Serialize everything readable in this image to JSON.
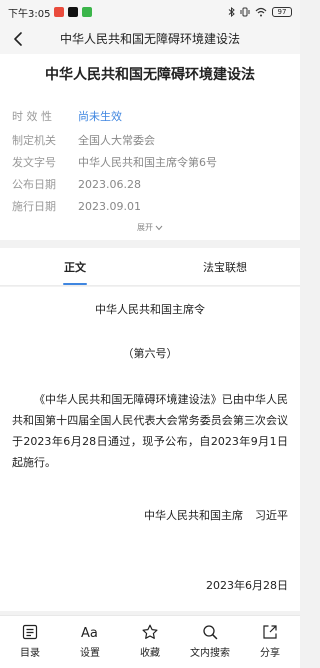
{
  "status_bar": {
    "time": "下午3:05",
    "battery": "97"
  },
  "header": {
    "title": "中华人民共和国无障碍环境建设法"
  },
  "info": {
    "doc_title": "中华人民共和国无障碍环境建设法",
    "fields": [
      {
        "label": "时 效 性",
        "value": "尚未生效"
      },
      {
        "label": "制定机关",
        "value": "全国人大常委会"
      },
      {
        "label": "发文字号",
        "value": "中华人民共和国主席令第6号"
      },
      {
        "label": "公布日期",
        "value": "2023.06.28"
      },
      {
        "label": "施行日期",
        "value": "2023.09.01"
      }
    ],
    "expand_label": "展开"
  },
  "tabs": [
    {
      "label": "正文",
      "active": true
    },
    {
      "label": "法宝联想",
      "active": false
    }
  ],
  "content": {
    "heading": "中华人民共和国主席令",
    "number": "（第六号）",
    "paragraph": "《中华人民共和国无障碍环境建设法》已由中华人民共和国第十四届全国人民代表大会常务委员会第三次会议于2023年6月28日通过，现予公布，自2023年9月1日起施行。",
    "signature_title": "中华人民共和国主席",
    "signature_name": "习近平",
    "date": "2023年6月28日"
  },
  "bottom_nav": [
    {
      "label": "目录",
      "icon": "list-icon"
    },
    {
      "label": "设置",
      "icon": "font-settings-icon"
    },
    {
      "label": "收藏",
      "icon": "star-icon"
    },
    {
      "label": "文内搜索",
      "icon": "search-icon"
    },
    {
      "label": "分享",
      "icon": "share-icon"
    }
  ],
  "colors": {
    "accent": "#3f86e0",
    "muted_text": "#9a9a9a",
    "background": "#f2f2f2"
  }
}
